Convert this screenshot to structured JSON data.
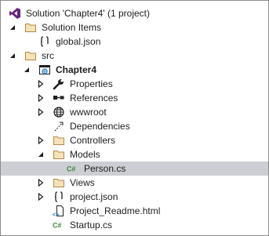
{
  "tree": {
    "solution": {
      "label": "Solution 'Chapter4' (1 project)",
      "icon": "visual-studio-solution-icon"
    },
    "solution_items": {
      "label": "Solution Items",
      "icon": "folder-icon"
    },
    "global_json": {
      "label": "global.json",
      "icon": "json-file-icon"
    },
    "src": {
      "label": "src",
      "icon": "folder-icon"
    },
    "project": {
      "label": "Chapter4",
      "icon": "web-project-icon"
    },
    "properties": {
      "label": "Properties",
      "icon": "wrench-icon"
    },
    "references": {
      "label": "References",
      "icon": "references-icon"
    },
    "wwwroot": {
      "label": "wwwroot",
      "icon": "globe-icon"
    },
    "dependencies": {
      "label": "Dependencies",
      "icon": "dependencies-icon"
    },
    "controllers": {
      "label": "Controllers",
      "icon": "folder-icon"
    },
    "models": {
      "label": "Models",
      "icon": "folder-icon"
    },
    "person_cs": {
      "label": "Person.cs",
      "icon": "csharp-file-icon"
    },
    "views": {
      "label": "Views",
      "icon": "folder-icon"
    },
    "project_json": {
      "label": "project.json",
      "icon": "json-file-icon"
    },
    "project_readme": {
      "label": "Project_Readme.html",
      "icon": "html-file-icon"
    },
    "startup_cs": {
      "label": "Startup.cs",
      "icon": "csharp-file-icon"
    }
  },
  "colors": {
    "selection": "#ccced3",
    "folder": "#dcb67a",
    "csharp": "#388a34",
    "vs_purple": "#68217a"
  }
}
